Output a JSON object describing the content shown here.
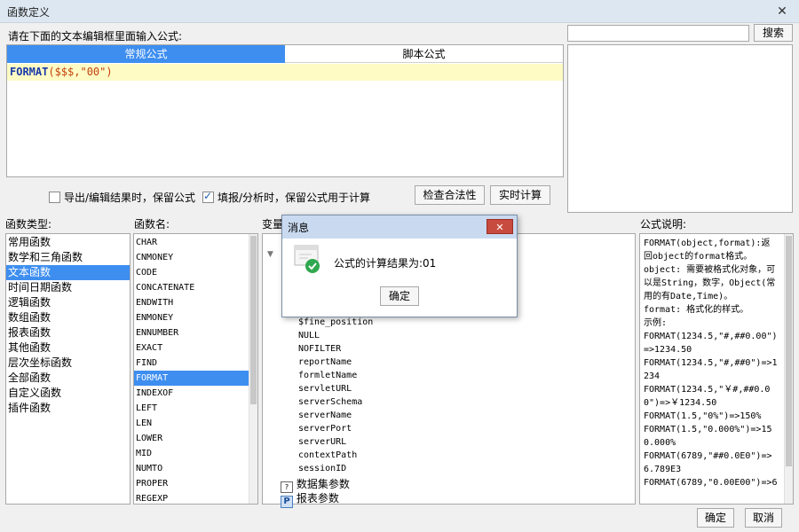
{
  "window": {
    "title": "函数定义",
    "close": "✕"
  },
  "editor": {
    "prompt": "请在下面的文本编辑框里面输入公式:",
    "tabs": [
      {
        "label": "常规公式"
      },
      {
        "label": "脚本公式"
      }
    ],
    "code_fn": "FORMAT",
    "code_args": "($$$,\"00\")"
  },
  "search": {
    "value": "",
    "button": "搜索"
  },
  "options": {
    "keep_formula_export": "导出/编辑结果时，保留公式",
    "keep_formula_fill": "填报/分析时，保留公式用于计算",
    "check_button": "检查合法性",
    "realtime_button": "实时计算"
  },
  "function_types": {
    "header": "函数类型:",
    "items": [
      "常用函数",
      "数学和三角函数",
      "文本函数",
      "时间日期函数",
      "逻辑函数",
      "数组函数",
      "报表函数",
      "其他函数",
      "层次坐标函数",
      "全部函数",
      "自定义函数",
      "插件函数"
    ]
  },
  "function_names": {
    "header": "函数名:",
    "items": [
      "CHAR",
      "CNMONEY",
      "CODE",
      "CONCATENATE",
      "ENDWITH",
      "ENMONEY",
      "ENNUMBER",
      "EXACT",
      "FIND",
      "FORMAT",
      "INDEXOF",
      "LEFT",
      "LEN",
      "LOWER",
      "MID",
      "NUMTO",
      "PROPER",
      "REGEXP"
    ]
  },
  "variables": {
    "header": "变量",
    "items": [
      "$fine_position",
      "NULL",
      "NOFILTER",
      "reportName",
      "formletName",
      "servletURL",
      "serverSchema",
      "serverName",
      "serverPort",
      "serverURL",
      "contextPath",
      "sessionID"
    ],
    "group_dataset": "数据集参数",
    "group_report": "报表参数"
  },
  "description": {
    "header": "公式说明:",
    "text": "FORMAT(object,format):返回object的format格式。\nobject: 需要被格式化对象，可以是String，数字，Object(常用的有Date,Time)。\nformat: 格式化的样式。\n示例:\nFORMAT(1234.5,\"#,##0.00\")=>1234.50\nFORMAT(1234.5,\"#,##0\")=>1234\nFORMAT(1234.5,\"￥#,##0.00\")=>￥1234.50\nFORMAT(1.5,\"0%\")=>150%\nFORMAT(1.5,\"0.000%\")=>150.000%\nFORMAT(6789,\"##0.0E0\")=>6.789E3\nFORMAT(6789,\"0.00E00\")=>6"
  },
  "dialog": {
    "title": "消息",
    "close": "✕",
    "message": "公式的计算结果为:01",
    "ok": "确定"
  },
  "footer": {
    "ok": "确定",
    "cancel": "取消"
  }
}
